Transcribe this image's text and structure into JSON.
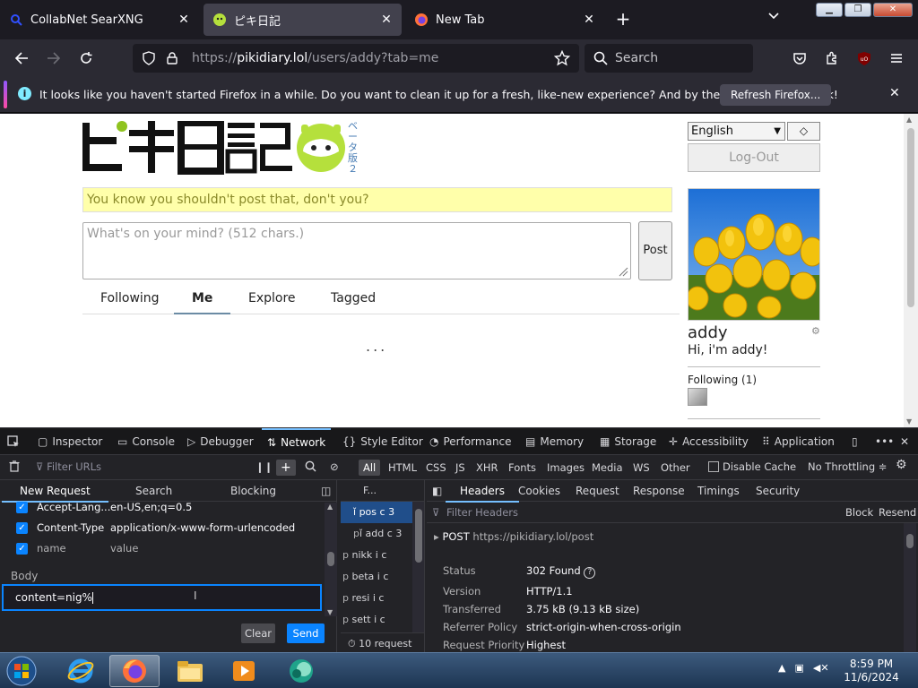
{
  "tabs": [
    {
      "title": "CollabNet SearXNG",
      "active": false
    },
    {
      "title": "ピキ日記",
      "active": true
    },
    {
      "title": "New Tab",
      "active": false
    }
  ],
  "nav": {
    "url_prefix": "https://",
    "url_host": "pikidiary.lol",
    "url_path": "/users/addy?tab=me",
    "search_placeholder": "Search"
  },
  "notification": {
    "message": "It looks like you haven't started Firefox in a while. Do you want to clean it up for a fresh, like-new experience? And by the way, welcome back!",
    "button": "Refresh Firefox..."
  },
  "page": {
    "logo_beta": "ベータ版２",
    "tagline": "You know you shouldn't post that, don't you?",
    "post_placeholder": "What's on your mind? (512 chars.)",
    "post_button": "Post",
    "tabs": [
      "Following",
      "Me",
      "Explore",
      "Tagged"
    ],
    "loading": "...",
    "language": "English",
    "logout": "Log-Out",
    "username": "addy",
    "bio": "Hi, i'm addy!",
    "following": "Following (1)"
  },
  "devtools": {
    "tabs": [
      "Inspector",
      "Console",
      "Debugger",
      "Network",
      "Style Editor",
      "Performance",
      "Memory",
      "Storage",
      "Accessibility",
      "Application"
    ],
    "filter_placeholder": "Filter URLs",
    "types": [
      "All",
      "HTML",
      "CSS",
      "JS",
      "XHR",
      "Fonts",
      "Images",
      "Media",
      "WS",
      "Other"
    ],
    "disable_cache": "Disable Cache",
    "throttling": "No Throttling ≑",
    "newreq_tabs": [
      "New Request",
      "Search",
      "Blocking"
    ],
    "headers": [
      {
        "key": "Accept-Lang...",
        "value": "en-US,en;q=0.5"
      },
      {
        "key": "Content-Type",
        "value": "application/x-www-form-urlencoded"
      },
      {
        "key": "name",
        "value": "value"
      }
    ],
    "body_label": "Body",
    "body_value": "content=nig%",
    "clear": "Clear",
    "send": "Send",
    "list_header": "F...",
    "requests": [
      {
        "name": "pos",
        "type": "c",
        "size": "3"
      },
      {
        "name": "add",
        "type": "c",
        "size": "3"
      },
      {
        "name": "nikk",
        "type": "i",
        "size": "c"
      },
      {
        "name": "beta",
        "type": "i",
        "size": "c"
      },
      {
        "name": "resi",
        "type": "i",
        "size": "c"
      },
      {
        "name": "sett",
        "type": "i",
        "size": "c"
      }
    ],
    "request_methods": [
      "",
      "p",
      "p",
      "p",
      "p",
      "p"
    ],
    "request_count": "10 request",
    "detail_tabs": [
      "Headers",
      "Cookies",
      "Request",
      "Response",
      "Timings",
      "Security"
    ],
    "filter_headers": "Filter Headers",
    "block": "Block",
    "resend": "Resend",
    "post_line": "POST",
    "post_url": "https://pikidiary.lol/post",
    "details": [
      {
        "key": "Status",
        "value": "302 Found"
      },
      {
        "key": "Version",
        "value": "HTTP/1.1"
      },
      {
        "key": "Transferred",
        "value": "3.75 kB (9.13 kB size)"
      },
      {
        "key": "Referrer Policy",
        "value": "strict-origin-when-cross-origin"
      },
      {
        "key": "Request Priority",
        "value": "Highest"
      }
    ]
  },
  "taskbar": {
    "time": "8:59 PM",
    "date": "11/6/2024"
  }
}
